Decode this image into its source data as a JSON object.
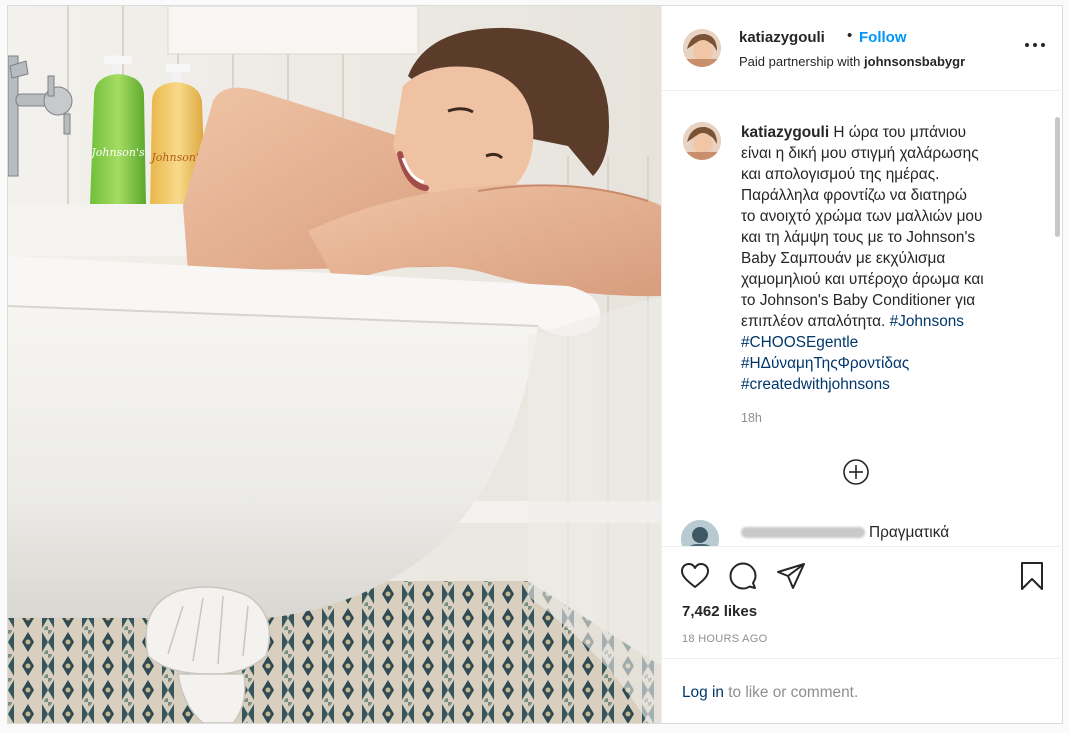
{
  "post": {
    "username": "katiazygouli",
    "separator": "•",
    "follow_label": "Follow",
    "partnership_prefix": "Paid partnership with",
    "partner": "johnsonsbabygr",
    "photo_alt": "Woman resting on the edge of a white clawfoot bathtub with two Johnson's shampoo bottles",
    "bottle_brand": "Johnson's"
  },
  "caption": {
    "username": "katiazygouli",
    "lines": [
      "Η ώρα του μπάνιου",
      "είναι η δική μου στιγμή χαλάρωσης",
      "και απολογισμού της ημέρας.",
      "Παράλληλα φροντίζω να διατηρώ",
      "το ανοιχτό χρώμα των μαλλιών μου",
      "και τη λάμψη τους με το Johnson's",
      "Baby Σαμπουάν με εκχύλισμα",
      "χαμομηλιού και υπέροχο άρωμα και",
      "το Johnson's Baby Conditioner για",
      "επιπλέον απαλότητα."
    ],
    "hashtags": [
      "#Johnsons",
      "#CHOOSEgentle",
      "#ΗΔύναμηΤηςΦροντίδας",
      "#createdwithjohnsons"
    ],
    "time": "18h"
  },
  "next_comment": {
    "text": "Πραγματικά"
  },
  "actions": {
    "likes": "7,462 likes",
    "time_ago": "18 HOURS AGO"
  },
  "login": {
    "link": "Log in",
    "rest": " to like or comment."
  },
  "colors": {
    "accent": "#0095f6",
    "hashtag": "#00376b",
    "muted": "#8e8e8e",
    "text": "#262626"
  }
}
